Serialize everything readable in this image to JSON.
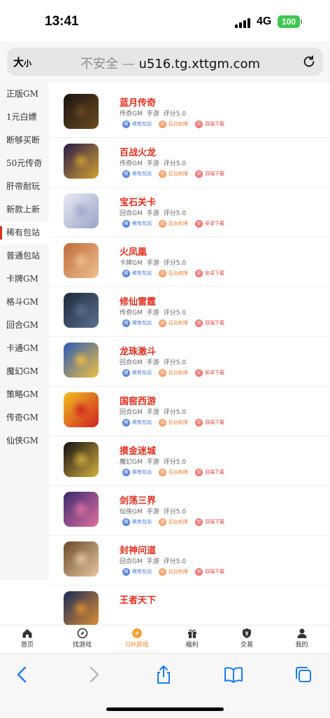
{
  "status": {
    "time": "13:41",
    "network": "4G",
    "battery": "100"
  },
  "browser": {
    "text_size_big": "大",
    "text_size_small": "小",
    "security_label": "不安全",
    "separator": "—",
    "domain": "u516.tg.xttgm.com"
  },
  "sidebar": {
    "items": [
      {
        "label": "正版GM"
      },
      {
        "label": "1元白嫖"
      },
      {
        "label": "断够买断"
      },
      {
        "label": "50元传奇"
      },
      {
        "label": "肝帝耐玩"
      },
      {
        "label": "新款上新"
      },
      {
        "label": "稀有包站",
        "active": true
      },
      {
        "label": "普通包站"
      },
      {
        "label": "卡牌GM"
      },
      {
        "label": "格斗GM"
      },
      {
        "label": "回合GM"
      },
      {
        "label": "卡通GM"
      },
      {
        "label": "魔幻GM"
      },
      {
        "label": "策略GM"
      },
      {
        "label": "传奇GM"
      },
      {
        "label": "仙侠GM"
      }
    ]
  },
  "games": [
    {
      "name": "蓝月传奇",
      "genre": "传奇GM",
      "platform": "手游",
      "score": "评分5.0",
      "icon": "game-icon-lanyue",
      "colors": [
        "#1a1410",
        "#6b4a20"
      ],
      "tags": [
        {
          "icon": "稀",
          "label": "稀有包站"
        },
        {
          "icon": "后",
          "label": "后台权限"
        },
        {
          "icon": "双",
          "label": "双端下载"
        }
      ]
    },
    {
      "name": "百战火龙",
      "genre": "传奇GM",
      "platform": "手游",
      "score": "评分5.0",
      "icon": "game-icon-baizhan",
      "colors": [
        "#2a1a4a",
        "#d4a030"
      ],
      "tags": [
        {
          "icon": "稀",
          "label": "稀有包站"
        },
        {
          "icon": "后",
          "label": "后台权限"
        },
        {
          "icon": "双",
          "label": "双端下载"
        }
      ]
    },
    {
      "name": "宝石关卡",
      "genre": "回合GM",
      "platform": "手游",
      "score": "评分5.0",
      "icon": "game-icon-baoshi",
      "colors": [
        "#e8eaf2",
        "#9aa4c8"
      ],
      "tags": [
        {
          "icon": "稀",
          "label": "稀有包站"
        },
        {
          "icon": "后",
          "label": "后台权限"
        },
        {
          "icon": "安",
          "label": "安卓下载"
        }
      ]
    },
    {
      "name": "火凤凰",
      "genre": "卡牌GM",
      "platform": "手游",
      "score": "评分5.0",
      "icon": "game-icon-huofeng",
      "colors": [
        "#c06a3a",
        "#f0c090"
      ],
      "tags": [
        {
          "icon": "稀",
          "label": "稀有包站"
        },
        {
          "icon": "后",
          "label": "后台权限"
        },
        {
          "icon": "安",
          "label": "安卓下载"
        }
      ]
    },
    {
      "name": "修仙雷霆",
      "genre": "传奇GM",
      "platform": "手游",
      "score": "评分5.0",
      "icon": "game-icon-xiuxian",
      "colors": [
        "#1e2a3a",
        "#5a7090"
      ],
      "tags": [
        {
          "icon": "稀",
          "label": "稀有包站"
        },
        {
          "icon": "后",
          "label": "后台权限"
        },
        {
          "icon": "双",
          "label": "双端下载"
        }
      ]
    },
    {
      "name": "龙珠激斗",
      "genre": "回合GM",
      "platform": "手游",
      "score": "评分5.0",
      "icon": "game-icon-longzhu",
      "colors": [
        "#2a5ab8",
        "#f0c040"
      ],
      "tags": [
        {
          "icon": "稀",
          "label": "稀有包站"
        },
        {
          "icon": "后",
          "label": "后台权限"
        },
        {
          "icon": "安",
          "label": "安卓下载"
        }
      ]
    },
    {
      "name": "国窖西游",
      "genre": "回合GM",
      "platform": "手游",
      "score": "评分5.0",
      "icon": "game-icon-guojiao",
      "colors": [
        "#f0c020",
        "#d02020"
      ],
      "tags": [
        {
          "icon": "稀",
          "label": "稀有包站"
        },
        {
          "icon": "后",
          "label": "后台权限"
        },
        {
          "icon": "双",
          "label": "双端下载"
        }
      ]
    },
    {
      "name": "摸金迷城",
      "genre": "魔幻GM",
      "platform": "手游",
      "score": "评分5.0",
      "icon": "game-icon-mojin",
      "colors": [
        "#101010",
        "#d8b040"
      ],
      "tags": [
        {
          "icon": "稀",
          "label": "稀有包站"
        },
        {
          "icon": "后",
          "label": "后台权限"
        },
        {
          "icon": "双",
          "label": "双端下载"
        }
      ]
    },
    {
      "name": "剑荡三界",
      "genre": "仙侠GM",
      "platform": "手游",
      "score": "评分5.0",
      "icon": "game-icon-jiandang",
      "colors": [
        "#3a2a70",
        "#e070a0"
      ],
      "tags": [
        {
          "icon": "稀",
          "label": "稀有包站"
        },
        {
          "icon": "后",
          "label": "后台权限"
        },
        {
          "icon": "双",
          "label": "双端下载"
        }
      ]
    },
    {
      "name": "封神问道",
      "genre": "回合GM",
      "platform": "手游",
      "score": "评分5.0",
      "icon": "game-icon-fengshen",
      "colors": [
        "#6a4a2a",
        "#e8c8a0"
      ],
      "tags": [
        {
          "icon": "稀",
          "label": "稀有包站"
        },
        {
          "icon": "后",
          "label": "后台权限"
        },
        {
          "icon": "双",
          "label": "双端下载"
        }
      ]
    },
    {
      "name": "王者天下",
      "genre": "",
      "platform": "",
      "score": "",
      "icon": "game-icon-wangzhe",
      "colors": [
        "#1a2a5a",
        "#e09030"
      ],
      "tags": []
    }
  ],
  "tabbar": {
    "items": [
      {
        "label": "首页",
        "icon": "home-icon"
      },
      {
        "label": "找游戏",
        "icon": "compass-icon"
      },
      {
        "label": "GM游戏",
        "icon": "gm-icon",
        "active": true
      },
      {
        "label": "福利",
        "icon": "gift-icon"
      },
      {
        "label": "交易",
        "icon": "shield-icon"
      },
      {
        "label": "我的",
        "icon": "user-icon"
      }
    ]
  },
  "colors": {
    "accent": "#e0301e",
    "tab_active": "#f28a2e",
    "ios_blue": "#1a7cf5"
  }
}
